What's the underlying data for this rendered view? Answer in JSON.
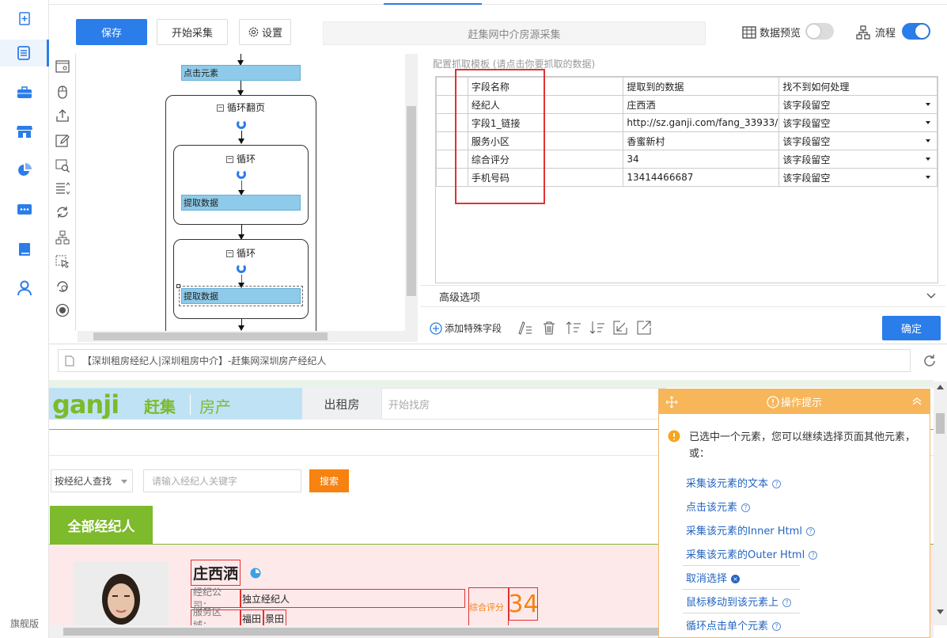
{
  "rail": {
    "edition_label": "旗舰版"
  },
  "toolbar": {
    "save_label": "保存",
    "start_label": "开始采集",
    "settings_label": "设置",
    "task_name": "赶集网中介房源采集",
    "preview_label": "数据预览",
    "preview_on": false,
    "flow_label": "流程",
    "flow_on": true
  },
  "flow": {
    "click_node": "点击元素",
    "paging_loop": "循环翻页",
    "loop1": "循环",
    "extract1": "提取数据",
    "loop2": "循环",
    "extract2": "提取数据"
  },
  "config": {
    "hint": "配置抓取模板 (请点击你要抓取的数据)",
    "columns": [
      "字段名称",
      "提取到的数据",
      "找不到如何处理"
    ],
    "rows": [
      [
        "经纪人",
        "庄西洒",
        "该字段留空"
      ],
      [
        "字段1_链接",
        "http://sz.ganji.com/fang_33933/",
        "该字段留空"
      ],
      [
        "服务小区",
        "香蜜新村",
        "该字段留空"
      ],
      [
        "综合评分",
        "34",
        "该字段留空"
      ],
      [
        "手机号码",
        "13414466687",
        "该字段留空"
      ]
    ],
    "advanced_label": "高级选项",
    "add_special_label": "添加特殊字段",
    "ok_label": "确定"
  },
  "browser": {
    "page_title": "【深圳租房经纪人|深圳租房中介】-赶集网深圳房产经纪人",
    "logo_text": "ganji",
    "logo_cn": "赶集",
    "logo_sub": "房产",
    "rent_tab": "出租房",
    "search_placeholder": "开始找房",
    "agent_select": "按经纪人查找",
    "agent_placeholder": "请输入经纪人关键字",
    "search_btn": "搜索",
    "all_agents": "全部经纪人",
    "agent_name": "庄西洒",
    "company_label": "经纪公司：",
    "company_value": "独立经纪人",
    "score_label": "综合评分",
    "score_value": "34",
    "area_label": "服务区域：",
    "area1": "福田",
    "area2": "景田"
  },
  "tips": {
    "title": "操作提示",
    "message": "已选中一个元素，您可以继续选择页面其他元素，或：",
    "links": [
      "采集该元素的文本",
      "点击该元素",
      "采集该元素的Inner Html",
      "采集该元素的Outer Html",
      "取消选择",
      "鼠标移动到该元素上",
      "循环点击单个元素"
    ]
  },
  "colors": {
    "accent": "#2b7de9",
    "warning": "#f7b65a",
    "highlight": "#e03232",
    "ganji_green": "#7dba2c"
  }
}
